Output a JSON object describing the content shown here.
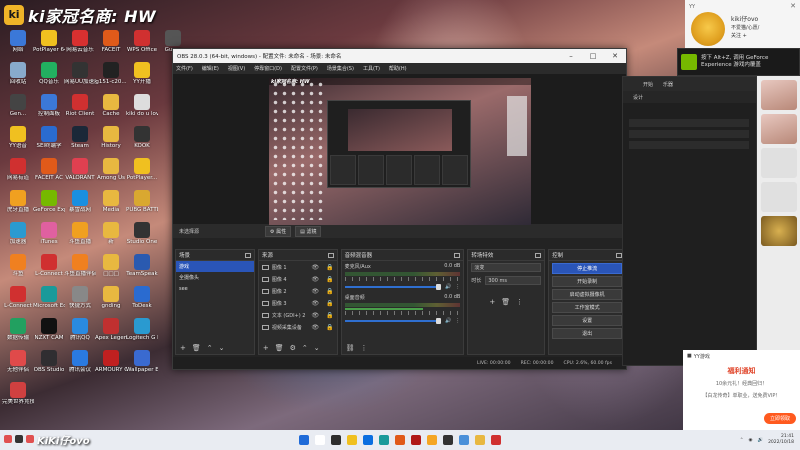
{
  "stream_overlay": {
    "logo": "ki",
    "title": "ki家冠名商: HW"
  },
  "desktop_icons": [
    {
      "label": "网络",
      "color": "#3b78d8"
    },
    {
      "label": "PotPlayer 64 bit",
      "color": "#f0c020"
    },
    {
      "label": "网易云音乐",
      "color": "#d83030"
    },
    {
      "label": "FACEIT",
      "color": "#e05a1a"
    },
    {
      "label": "WPS Office",
      "color": "#d03030"
    },
    {
      "label": "Guess",
      "color": "#555"
    },
    {
      "label": "回收站",
      "color": "#88aacc"
    },
    {
      "label": "QQ音乐",
      "color": "#22b060"
    },
    {
      "label": "网易UU加速器",
      "color": "#333"
    },
    {
      "label": "g151-c20...",
      "color": "#222"
    },
    {
      "label": "YY开播",
      "color": "#f0c020"
    },
    {
      "label": "Gen...",
      "color": "#444"
    },
    {
      "label": "控制面板",
      "color": "#3b78d8"
    },
    {
      "label": "Riot Client",
      "color": "#d03030"
    },
    {
      "label": "Cache",
      "color": "#e8b840"
    },
    {
      "label": "kiki do u love me?...",
      "color": "#ddd"
    },
    {
      "label": "YY语音",
      "color": "#f0c020"
    },
    {
      "label": "SEI终端学",
      "color": "#2a6bd0"
    },
    {
      "label": "Steam",
      "color": "#1b2838"
    },
    {
      "label": "History",
      "color": "#e8b840"
    },
    {
      "label": "KOOK",
      "color": "#333"
    },
    {
      "label": "网易有道",
      "color": "#d03030"
    },
    {
      "label": "FACEIT AC",
      "color": "#e05a1a"
    },
    {
      "label": "VALORANT",
      "color": "#e04050"
    },
    {
      "label": "Among Us",
      "color": "#e8b840"
    },
    {
      "label": "PotPlayer...",
      "color": "#f0c020"
    },
    {
      "label": "虎牙直播",
      "color": "#f0a020"
    },
    {
      "label": "GeForce Experience",
      "color": "#76b900"
    },
    {
      "label": "暴雪战网",
      "color": "#1a8fe0"
    },
    {
      "label": "Media",
      "color": "#e8b840"
    },
    {
      "label": "PUBG BATTLEGR...",
      "color": "#d9a830"
    },
    {
      "label": "加速器",
      "color": "#2a9ad0"
    },
    {
      "label": "iTunes",
      "color": "#e060a0"
    },
    {
      "label": "斗鱼直播",
      "color": "#f0a020"
    },
    {
      "label": "新",
      "color": "#e8b840"
    },
    {
      "label": "Studio One",
      "color": "#333"
    },
    {
      "label": "斗鱼",
      "color": "#f08020"
    },
    {
      "label": "L-Connect",
      "color": "#d03030"
    },
    {
      "label": "斗鱼直播伴侣",
      "color": "#f08020"
    },
    {
      "label": "□□□",
      "color": "#e8b840"
    },
    {
      "label": "TeamSpeak",
      "color": "#2a5ab0"
    },
    {
      "label": "L-Connect",
      "color": "#d03030"
    },
    {
      "label": "Microsoft Edge",
      "color": "#1a9a9a"
    },
    {
      "label": "快捷方式",
      "color": "#888"
    },
    {
      "label": "gnding",
      "color": "#e8b840"
    },
    {
      "label": "ToDesk",
      "color": "#2a6bd0"
    },
    {
      "label": "数据传输",
      "color": "#22a060"
    },
    {
      "label": "NZXT CAM",
      "color": "#111"
    },
    {
      "label": "腾讯QQ",
      "color": "#2a8ae0"
    },
    {
      "label": "Apex Legends",
      "color": "#c03030"
    },
    {
      "label": "Logitech G HUB",
      "color": "#2a9ad0"
    },
    {
      "label": "无他伴侣",
      "color": "#e04a4a"
    },
    {
      "label": "OBS Studio",
      "color": "#302e31"
    },
    {
      "label": "腾讯会议",
      "color": "#2a7ae0"
    },
    {
      "label": "ARMOURY CRATE",
      "color": "#c02020"
    },
    {
      "label": "Wallpaper Engine: ...",
      "color": "#3a6ad0"
    },
    {
      "label": "完美世界竞技平台",
      "color": "#d04040"
    }
  ],
  "obs": {
    "title": "OBS 28.0.3 (64-bit, windows) - 配置文件: 未命名 - 场景: 未命名",
    "menu": [
      "文件(F)",
      "编辑(E)",
      "视图(V)",
      "停靠窗口(D)",
      "配置文件(P)",
      "场景集合(S)",
      "工具(T)",
      "帮助(H)"
    ],
    "no_source": "未选择源",
    "btn_properties": "属性",
    "btn_filters": "滤镜",
    "scenes": {
      "title": "场景",
      "items": [
        "游戏",
        "全摄像头",
        "see"
      ]
    },
    "sources": {
      "title": "来源",
      "items": [
        "图像 1",
        "图像 4",
        "图像 2",
        "图像 3",
        "文本 (GDI+) 2",
        "视频采集设备"
      ]
    },
    "mixer": {
      "title": "音频混音器",
      "channels": [
        {
          "name": "麦克风/Aux",
          "db": "0.0 dB"
        },
        {
          "name": "桌面音频",
          "db": "0.0 dB"
        }
      ],
      "ticks": "-60 -55 -50 -45 -40 -35 -30 -25 -20 -15 -10 -5 0"
    },
    "transitions": {
      "title": "转场特效",
      "type": "淡变",
      "duration_label": "时长",
      "duration": "300 ms"
    },
    "controls": {
      "title": "控制",
      "buttons": [
        "停止推流",
        "开始录制",
        "启动虚拟摄像机",
        "工作室模式",
        "设置",
        "退出"
      ]
    },
    "status": {
      "live": "LIVE: 00:00:00",
      "rec": "REC: 00:00:00",
      "cpu": "CPU: 2.6%, 60.00 fps"
    }
  },
  "nvidia_toast": {
    "line1": "按下 Alt+Z, 调用 GeForce",
    "line2": "Experience 游戏内覆盖"
  },
  "chat": {
    "user": "YY",
    "name": "kiki仔ovo",
    "msg": "不爱猫/心愿/",
    "msg2": "关注 +"
  },
  "right_app": {
    "tabs": [
      "开始",
      "乐器"
    ],
    "subtab": "设计"
  },
  "welfare": {
    "title": "YY游戏",
    "heading": "福利通知",
    "body1": "10余元礼！经典回归！",
    "body2": "【白龙传奇】单职业，送免费VIP！",
    "button": "立即领取"
  },
  "bottom_overlay": {
    "name": "KiKi仔ovo"
  },
  "tray": {
    "time": "21:41",
    "date": "2022/10/18"
  },
  "taskbar_apps": [
    "#1f6ad8",
    "#ffffff",
    "#2d2d2d",
    "#f0c020",
    "#0a6ee0",
    "#1a9a9a",
    "#e05a1a",
    "#b01818",
    "#f5a623",
    "#333333",
    "#4a90d9",
    "#e8b840",
    "#d03030"
  ]
}
